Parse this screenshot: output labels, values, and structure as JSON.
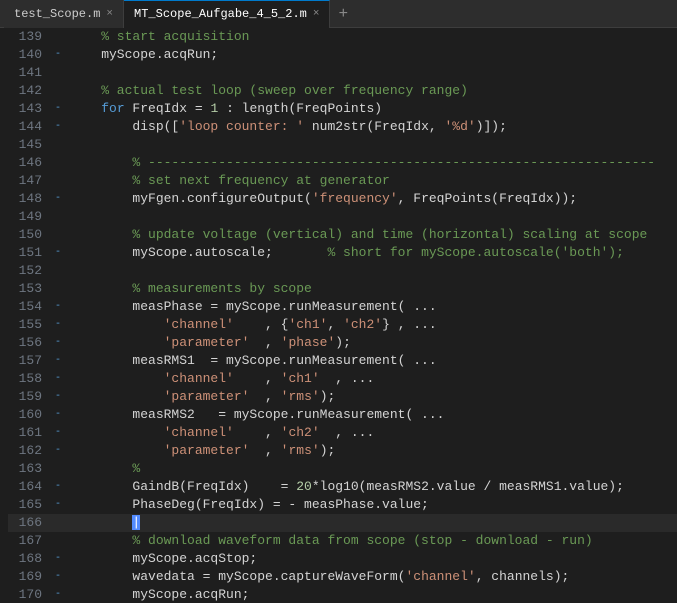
{
  "tabs": [
    {
      "label": "test_Scope.m",
      "active": false,
      "id": "tab1"
    },
    {
      "label": "MT_Scope_Aufgabe_4_5_2.m",
      "active": true,
      "id": "tab2"
    }
  ],
  "add_tab_label": "+",
  "lines": [
    {
      "num": 139,
      "gutter": "",
      "code": "    % start acquisition",
      "type": "comment"
    },
    {
      "num": 140,
      "gutter": "-",
      "code": "    myScope.acqRun;",
      "type": "code"
    },
    {
      "num": 141,
      "gutter": "",
      "code": "",
      "type": "blank"
    },
    {
      "num": 142,
      "gutter": "",
      "code": "    % actual test loop (sweep over frequency range)",
      "type": "comment"
    },
    {
      "num": 143,
      "gutter": "-",
      "code": "    for FreqIdx = 1 : length(FreqPoints)",
      "type": "code"
    },
    {
      "num": 144,
      "gutter": "-",
      "code": "        disp(['loop counter: ' num2str(FreqIdx, '%d')]);",
      "type": "code"
    },
    {
      "num": 145,
      "gutter": "",
      "code": "",
      "type": "blank"
    },
    {
      "num": 146,
      "gutter": "",
      "code": "        % -----------------------------------------------------------------",
      "type": "comment"
    },
    {
      "num": 147,
      "gutter": "",
      "code": "        % set next frequency at generator",
      "type": "comment"
    },
    {
      "num": 148,
      "gutter": "-",
      "code": "        myFgen.configureOutput('frequency', FreqPoints(FreqIdx));",
      "type": "code"
    },
    {
      "num": 149,
      "gutter": "",
      "code": "",
      "type": "blank"
    },
    {
      "num": 150,
      "gutter": "",
      "code": "        % update voltage (vertical) and time (horizontal) scaling at scope",
      "type": "comment"
    },
    {
      "num": 151,
      "gutter": "-",
      "code": "        myScope.autoscale;       % short for myScope.autoscale('both');",
      "type": "code"
    },
    {
      "num": 152,
      "gutter": "",
      "code": "",
      "type": "blank"
    },
    {
      "num": 153,
      "gutter": "",
      "code": "        % measurements by scope",
      "type": "comment"
    },
    {
      "num": 154,
      "gutter": "-",
      "code": "        measPhase = myScope.runMeasurement( ...",
      "type": "code"
    },
    {
      "num": 155,
      "gutter": "-",
      "code": "            'channel'    , {'ch1', 'ch2'} , ...",
      "type": "code"
    },
    {
      "num": 156,
      "gutter": "-",
      "code": "            'parameter'  , 'phase');",
      "type": "code"
    },
    {
      "num": 157,
      "gutter": "-",
      "code": "        measRMS1  = myScope.runMeasurement( ...",
      "type": "code"
    },
    {
      "num": 158,
      "gutter": "-",
      "code": "            'channel'    , 'ch1'  , ...",
      "type": "code"
    },
    {
      "num": 159,
      "gutter": "-",
      "code": "            'parameter'  , 'rms');",
      "type": "code"
    },
    {
      "num": 160,
      "gutter": "-",
      "code": "        measRMS2   = myScope.runMeasurement( ...",
      "type": "code"
    },
    {
      "num": 161,
      "gutter": "-",
      "code": "            'channel'    , 'ch2'  , ...",
      "type": "code"
    },
    {
      "num": 162,
      "gutter": "-",
      "code": "            'parameter'  , 'rms');",
      "type": "code"
    },
    {
      "num": 163,
      "gutter": "",
      "code": "        %",
      "type": "comment"
    },
    {
      "num": 164,
      "gutter": "-",
      "code": "        GaindB(FreqIdx)    = 20*log10(measRMS2.value / measRMS1.value);",
      "type": "code"
    },
    {
      "num": 165,
      "gutter": "-",
      "code": "        PhaseDeg(FreqIdx) = - measPhase.value;",
      "type": "code"
    },
    {
      "num": 166,
      "gutter": "",
      "code": "        |",
      "type": "cursor"
    },
    {
      "num": 167,
      "gutter": "",
      "code": "        % download waveform data from scope (stop - download - run)",
      "type": "comment"
    },
    {
      "num": 168,
      "gutter": "-",
      "code": "        myScope.acqStop;",
      "type": "code"
    },
    {
      "num": 169,
      "gutter": "-",
      "code": "        wavedata = myScope.captureWaveForm('channel', channels);",
      "type": "code"
    },
    {
      "num": 170,
      "gutter": "-",
      "code": "        myScope.acqRun;",
      "type": "code"
    }
  ]
}
